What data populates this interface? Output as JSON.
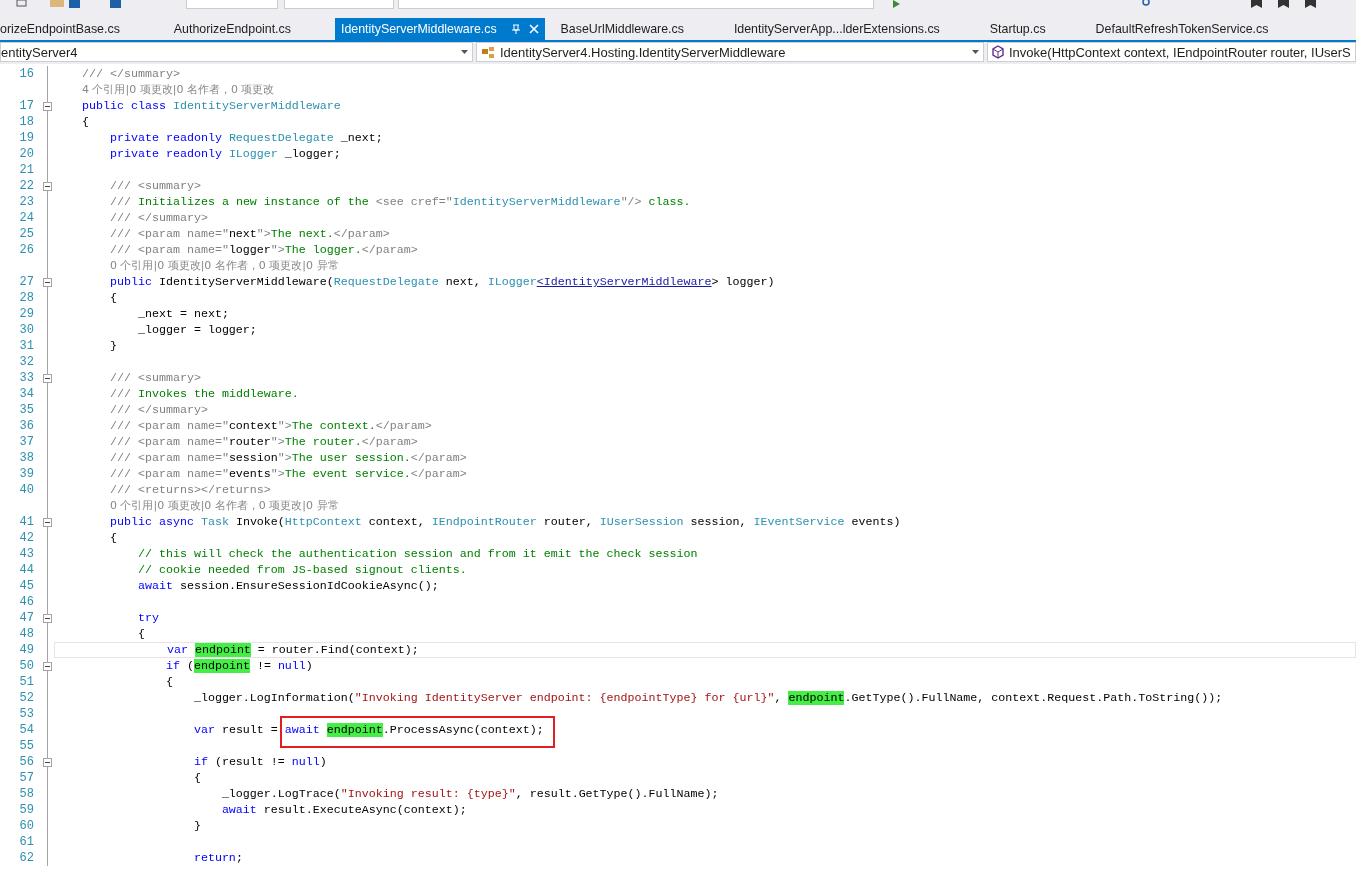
{
  "tabs": [
    {
      "label": "orizeEndpointBase.cs",
      "selected": false
    },
    {
      "label": "AuthorizeEndpoint.cs",
      "selected": false
    },
    {
      "label": "IdentityServerMiddleware.cs",
      "selected": true
    },
    {
      "label": "BaseUrlMiddleware.cs",
      "selected": false
    },
    {
      "label": "IdentityServerApp...lderExtensions.cs",
      "selected": false
    },
    {
      "label": "Startup.cs",
      "selected": false
    },
    {
      "label": "DefaultRefreshTokenService.cs",
      "selected": false
    }
  ],
  "navigation_bar": [
    {
      "kind": "project",
      "text": "entityServer4"
    },
    {
      "kind": "class",
      "text": "IdentityServer4.Hosting.IdentityServerMiddleware"
    },
    {
      "kind": "member",
      "text": "Invoke(HttpContext context, IEndpointRouter router, IUserS"
    }
  ],
  "editor": {
    "lines": [
      {
        "kind": "code",
        "number": "16",
        "foldable": false,
        "current": false,
        "tokens": [
          {
            "kind": "doc",
            "text": "    /// </summary>"
          }
        ]
      },
      {
        "kind": "codelens",
        "foldable": false,
        "current": false,
        "text": "    4 个引用|0 项更改|0 名作者，0 项更改"
      },
      {
        "kind": "code",
        "number": "17",
        "foldable": true,
        "current": false,
        "tokens": [
          {
            "kind": "keyword",
            "text": "    public class "
          },
          {
            "kind": "type",
            "text": "IdentityServerMiddleware"
          }
        ]
      },
      {
        "kind": "code",
        "number": "18",
        "foldable": false,
        "current": false,
        "tokens": [
          {
            "kind": "plain",
            "text": "    {"
          }
        ]
      },
      {
        "kind": "code",
        "number": "19",
        "foldable": false,
        "current": false,
        "tokens": [
          {
            "kind": "keyword",
            "text": "        private readonly "
          },
          {
            "kind": "type",
            "text": "RequestDelegate"
          },
          {
            "kind": "plain",
            "text": " _next;"
          }
        ]
      },
      {
        "kind": "code",
        "number": "20",
        "foldable": false,
        "current": false,
        "tokens": [
          {
            "kind": "keyword",
            "text": "        private readonly "
          },
          {
            "kind": "type",
            "text": "ILogger"
          },
          {
            "kind": "plain",
            "text": " _logger;"
          }
        ]
      },
      {
        "kind": "code",
        "number": "21",
        "foldable": false,
        "current": false
      },
      {
        "kind": "code",
        "number": "22",
        "foldable": true,
        "current": false,
        "tokens": [
          {
            "kind": "doc",
            "text": "        /// <summary>"
          }
        ]
      },
      {
        "kind": "code",
        "number": "23",
        "foldable": false,
        "current": false,
        "tokens": [
          {
            "kind": "doc",
            "text": "        /// "
          },
          {
            "kind": "comment",
            "text": "Initializes a new instance of the "
          },
          {
            "kind": "doc",
            "text": "<see cref=\""
          },
          {
            "kind": "type",
            "text": "IdentityServerMiddleware"
          },
          {
            "kind": "doc",
            "text": "\"/>"
          },
          {
            "kind": "comment",
            "text": " class."
          }
        ]
      },
      {
        "kind": "code",
        "number": "24",
        "foldable": false,
        "current": false,
        "tokens": [
          {
            "kind": "doc",
            "text": "        /// </summary>"
          }
        ]
      },
      {
        "kind": "code",
        "number": "25",
        "foldable": false,
        "current": false,
        "tokens": [
          {
            "kind": "doc",
            "text": "        /// <param name=\""
          },
          {
            "kind": "plain",
            "text": "next"
          },
          {
            "kind": "doc",
            "text": "\">"
          },
          {
            "kind": "comment",
            "text": "The next."
          },
          {
            "kind": "doc",
            "text": "</param>"
          }
        ]
      },
      {
        "kind": "code",
        "number": "26",
        "foldable": false,
        "current": false,
        "tokens": [
          {
            "kind": "doc",
            "text": "        /// <param name=\""
          },
          {
            "kind": "plain",
            "text": "logger"
          },
          {
            "kind": "doc",
            "text": "\">"
          },
          {
            "kind": "comment",
            "text": "The logger."
          },
          {
            "kind": "doc",
            "text": "</param>"
          }
        ]
      },
      {
        "kind": "codelens",
        "foldable": false,
        "current": false,
        "text": "        0 个引用|0 项更改|0 名作者，0 项更改|0 异常"
      },
      {
        "kind": "code",
        "number": "27",
        "foldable": true,
        "current": false,
        "tokens": [
          {
            "kind": "keyword",
            "text": "        public"
          },
          {
            "kind": "plain",
            "text": " IdentityServerMiddleware("
          },
          {
            "kind": "type",
            "text": "RequestDelegate"
          },
          {
            "kind": "plain",
            "text": " next, "
          },
          {
            "kind": "type",
            "text": "ILogger"
          },
          {
            "kind": "link",
            "text": "<IdentityServerMiddleware"
          },
          {
            "kind": "plain",
            "text": "> logger)"
          }
        ]
      },
      {
        "kind": "code",
        "number": "28",
        "foldable": false,
        "current": false,
        "tokens": [
          {
            "kind": "plain",
            "text": "        {"
          }
        ]
      },
      {
        "kind": "code",
        "number": "29",
        "foldable": false,
        "current": false,
        "tokens": [
          {
            "kind": "plain",
            "text": "            _next = next;"
          }
        ]
      },
      {
        "kind": "code",
        "number": "30",
        "foldable": false,
        "current": false,
        "tokens": [
          {
            "kind": "plain",
            "text": "            _logger = logger;"
          }
        ]
      },
      {
        "kind": "code",
        "number": "31",
        "foldable": false,
        "current": false,
        "tokens": [
          {
            "kind": "plain",
            "text": "        }"
          }
        ]
      },
      {
        "kind": "code",
        "number": "32",
        "foldable": false,
        "current": false
      },
      {
        "kind": "code",
        "number": "33",
        "foldable": true,
        "current": false,
        "tokens": [
          {
            "kind": "doc",
            "text": "        /// <summary>"
          }
        ]
      },
      {
        "kind": "code",
        "number": "34",
        "foldable": false,
        "current": false,
        "tokens": [
          {
            "kind": "doc",
            "text": "        /// "
          },
          {
            "kind": "comment",
            "text": "Invokes the middleware."
          }
        ]
      },
      {
        "kind": "code",
        "number": "35",
        "foldable": false,
        "current": false,
        "tokens": [
          {
            "kind": "doc",
            "text": "        /// </summary>"
          }
        ]
      },
      {
        "kind": "code",
        "number": "36",
        "foldable": false,
        "current": false,
        "tokens": [
          {
            "kind": "doc",
            "text": "        /// <param name=\""
          },
          {
            "kind": "plain",
            "text": "context"
          },
          {
            "kind": "doc",
            "text": "\">"
          },
          {
            "kind": "comment",
            "text": "The context."
          },
          {
            "kind": "doc",
            "text": "</param>"
          }
        ]
      },
      {
        "kind": "code",
        "number": "37",
        "foldable": false,
        "current": false,
        "tokens": [
          {
            "kind": "doc",
            "text": "        /// <param name=\""
          },
          {
            "kind": "plain",
            "text": "router"
          },
          {
            "kind": "doc",
            "text": "\">"
          },
          {
            "kind": "comment",
            "text": "The router."
          },
          {
            "kind": "doc",
            "text": "</param>"
          }
        ]
      },
      {
        "kind": "code",
        "number": "38",
        "foldable": false,
        "current": false,
        "tokens": [
          {
            "kind": "doc",
            "text": "        /// <param name=\""
          },
          {
            "kind": "plain",
            "text": "session"
          },
          {
            "kind": "doc",
            "text": "\">"
          },
          {
            "kind": "comment",
            "text": "The user session."
          },
          {
            "kind": "doc",
            "text": "</param>"
          }
        ]
      },
      {
        "kind": "code",
        "number": "39",
        "foldable": false,
        "current": false,
        "tokens": [
          {
            "kind": "doc",
            "text": "        /// <param name=\""
          },
          {
            "kind": "plain",
            "text": "events"
          },
          {
            "kind": "doc",
            "text": "\">"
          },
          {
            "kind": "comment",
            "text": "The event service."
          },
          {
            "kind": "doc",
            "text": "</param>"
          }
        ]
      },
      {
        "kind": "code",
        "number": "40",
        "foldable": false,
        "current": false,
        "tokens": [
          {
            "kind": "doc",
            "text": "        /// <returns></returns>"
          }
        ]
      },
      {
        "kind": "codelens",
        "foldable": false,
        "current": false,
        "text": "        0 个引用|0 项更改|0 名作者，0 项更改|0 异常"
      },
      {
        "kind": "code",
        "number": "41",
        "foldable": true,
        "current": false,
        "tokens": [
          {
            "kind": "keyword",
            "text": "        public async "
          },
          {
            "kind": "type",
            "text": "Task"
          },
          {
            "kind": "plain",
            "text": " Invoke("
          },
          {
            "kind": "type",
            "text": "HttpContext"
          },
          {
            "kind": "plain",
            "text": " context, "
          },
          {
            "kind": "type",
            "text": "IEndpointRouter"
          },
          {
            "kind": "plain",
            "text": " router, "
          },
          {
            "kind": "type",
            "text": "IUserSession"
          },
          {
            "kind": "plain",
            "text": " session, "
          },
          {
            "kind": "type",
            "text": "IEventService"
          },
          {
            "kind": "plain",
            "text": " events)"
          }
        ]
      },
      {
        "kind": "code",
        "number": "42",
        "foldable": false,
        "current": false,
        "tokens": [
          {
            "kind": "plain",
            "text": "        {"
          }
        ]
      },
      {
        "kind": "code",
        "number": "43",
        "foldable": false,
        "current": false,
        "tokens": [
          {
            "kind": "comment",
            "text": "            // this will check the authentication session and from it emit the check session"
          }
        ]
      },
      {
        "kind": "code",
        "number": "44",
        "foldable": false,
        "current": false,
        "tokens": [
          {
            "kind": "comment",
            "text": "            // cookie needed from JS-based signout clients."
          }
        ]
      },
      {
        "kind": "code",
        "number": "45",
        "foldable": false,
        "current": false,
        "tokens": [
          {
            "kind": "keyword",
            "text": "            await"
          },
          {
            "kind": "plain",
            "text": " session.EnsureSessionIdCookieAsync();"
          }
        ]
      },
      {
        "kind": "code",
        "number": "46",
        "foldable": false,
        "current": false
      },
      {
        "kind": "code",
        "number": "47",
        "foldable": true,
        "current": false,
        "tokens": [
          {
            "kind": "keyword",
            "text": "            try"
          }
        ]
      },
      {
        "kind": "code",
        "number": "48",
        "foldable": false,
        "current": false,
        "tokens": [
          {
            "kind": "plain",
            "text": "            {"
          }
        ]
      },
      {
        "kind": "code",
        "number": "49",
        "foldable": false,
        "current": true,
        "tokens": [
          {
            "kind": "keyword",
            "text": "                var "
          },
          {
            "kind": "highlight",
            "text": "endpoint"
          },
          {
            "kind": "plain",
            "text": " = router.Find(context);"
          }
        ]
      },
      {
        "kind": "code",
        "number": "50",
        "foldable": true,
        "current": false,
        "tokens": [
          {
            "kind": "keyword",
            "text": "                if"
          },
          {
            "kind": "plain",
            "text": " ("
          },
          {
            "kind": "highlight",
            "text": "endpoint"
          },
          {
            "kind": "plain",
            "text": " != "
          },
          {
            "kind": "keyword",
            "text": "null"
          },
          {
            "kind": "plain",
            "text": ")"
          }
        ]
      },
      {
        "kind": "code",
        "number": "51",
        "foldable": false,
        "current": false,
        "tokens": [
          {
            "kind": "plain",
            "text": "                {"
          }
        ]
      },
      {
        "kind": "code",
        "number": "52",
        "foldable": false,
        "current": false,
        "tokens": [
          {
            "kind": "plain",
            "text": "                    _logger.LogInformation("
          },
          {
            "kind": "string",
            "text": "\"Invoking IdentityServer endpoint: {endpointType} for {url}\""
          },
          {
            "kind": "plain",
            "text": ", "
          },
          {
            "kind": "highlight",
            "text": "endpoint"
          },
          {
            "kind": "plain",
            "text": ".GetType().FullName, context.Request.Path.ToString());"
          }
        ]
      },
      {
        "kind": "code",
        "number": "53",
        "foldable": false,
        "current": false
      },
      {
        "kind": "code",
        "number": "54",
        "foldable": false,
        "current": false,
        "tokens": [
          {
            "kind": "keyword",
            "text": "                    var"
          },
          {
            "kind": "plain",
            "text": " result = "
          },
          {
            "kind": "box",
            "tokens": [
              {
                "kind": "keyword",
                "text": "await "
              },
              {
                "kind": "highlight",
                "text": "endpoint"
              },
              {
                "kind": "plain",
                "text": ".ProcessAsync(context);"
              }
            ]
          }
        ]
      },
      {
        "kind": "code",
        "number": "55",
        "foldable": false,
        "current": false
      },
      {
        "kind": "code",
        "number": "56",
        "foldable": true,
        "current": false,
        "tokens": [
          {
            "kind": "keyword",
            "text": "                    if"
          },
          {
            "kind": "plain",
            "text": " (result != "
          },
          {
            "kind": "keyword",
            "text": "null"
          },
          {
            "kind": "plain",
            "text": ")"
          }
        ]
      },
      {
        "kind": "code",
        "number": "57",
        "foldable": false,
        "current": false,
        "tokens": [
          {
            "kind": "plain",
            "text": "                    {"
          }
        ]
      },
      {
        "kind": "code",
        "number": "58",
        "foldable": false,
        "current": false,
        "tokens": [
          {
            "kind": "plain",
            "text": "                        _logger.LogTrace("
          },
          {
            "kind": "string",
            "text": "\"Invoking result: {type}\""
          },
          {
            "kind": "plain",
            "text": ", result.GetType().FullName);"
          }
        ]
      },
      {
        "kind": "code",
        "number": "59",
        "foldable": false,
        "current": false,
        "tokens": [
          {
            "kind": "keyword",
            "text": "                        await"
          },
          {
            "kind": "plain",
            "text": " result.ExecuteAsync(context);"
          }
        ]
      },
      {
        "kind": "code",
        "number": "60",
        "foldable": false,
        "current": false,
        "tokens": [
          {
            "kind": "plain",
            "text": "                    }"
          }
        ]
      },
      {
        "kind": "code",
        "number": "61",
        "foldable": false,
        "current": false
      },
      {
        "kind": "code",
        "number": "62",
        "foldable": false,
        "current": false,
        "tokens": [
          {
            "kind": "keyword",
            "text": "                    return"
          },
          {
            "kind": "plain",
            "text": ";"
          }
        ]
      }
    ]
  }
}
